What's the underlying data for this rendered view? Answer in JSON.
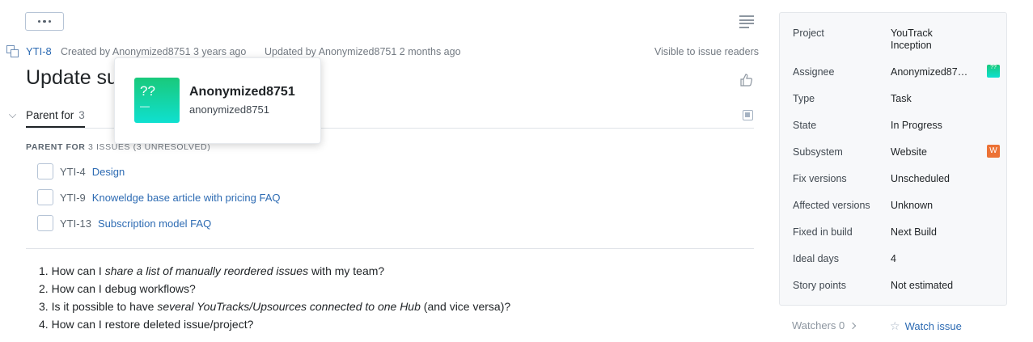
{
  "toolbar": {
    "more_label": "⋯"
  },
  "issue": {
    "id": "YTI-8",
    "created": "Created by Anonymized8751 3 years ago",
    "updated": "Updated by Anonymized8751 2 months ago",
    "visibility": "Visible to issue readers",
    "summary_visible": "Update su"
  },
  "links": {
    "tab_label": "Parent for",
    "tab_count": "3",
    "subhead_prefix": "PARENT FOR",
    "subhead_rest": "3 ISSUES (3 UNRESOLVED)",
    "items": [
      {
        "id": "YTI-4",
        "title": "Design"
      },
      {
        "id": "YTI-9",
        "title": "Knoweldge base article with pricing FAQ"
      },
      {
        "id": "YTI-13",
        "title": "Subscription model FAQ"
      }
    ]
  },
  "description": {
    "items": [
      {
        "num": "1.",
        "pre": "How can I ",
        "em": "share a list of manually reordered issues",
        "post": " with my team?"
      },
      {
        "num": "2.",
        "pre": "How can I debug workflows?",
        "em": "",
        "post": ""
      },
      {
        "num": "3.",
        "pre": "Is it possible to have ",
        "em": "several YouTracks/Upsources connected to one Hub",
        "post": " (and vice versa)?"
      },
      {
        "num": "4.",
        "pre": "How can I restore deleted issue/project?",
        "em": "",
        "post": ""
      }
    ]
  },
  "popup": {
    "avatar_text": "??",
    "avatar_dash": "—",
    "name": "Anonymized8751",
    "login": "anonymized8751"
  },
  "fields": [
    {
      "label": "Project",
      "value": "YouTrack Inception"
    },
    {
      "label": "Assignee",
      "value": "Anonymized87…",
      "badge": "??"
    },
    {
      "label": "Type",
      "value": "Task"
    },
    {
      "label": "State",
      "value": "In Progress"
    },
    {
      "label": "Subsystem",
      "value": "Website",
      "badge": "W"
    },
    {
      "label": "Fix versions",
      "value": "Unscheduled"
    },
    {
      "label": "Affected versions",
      "value": "Unknown"
    },
    {
      "label": "Fixed in build",
      "value": "Next Build"
    },
    {
      "label": "Ideal days",
      "value": "4"
    },
    {
      "label": "Story points",
      "value": "Not estimated"
    }
  ],
  "watch": {
    "watchers_label": "Watchers 0",
    "watch_label": "Watch issue"
  },
  "colors": {
    "link": "#2d6bb3",
    "subsystem_badge": "#ec7235",
    "avatar_start": "#19c97b",
    "avatar_end": "#0fe0d0"
  }
}
